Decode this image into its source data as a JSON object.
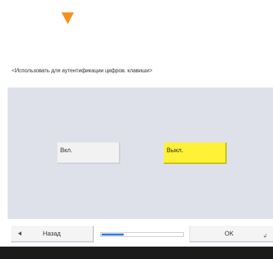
{
  "heading": "<Использовать для аутентификации цифров. клавиши>",
  "options": {
    "on_label": "Вкл.",
    "off_label": "Выкл.",
    "selected": "off"
  },
  "footer": {
    "back_label": "Назад",
    "ok_label": "OK",
    "progress": 0.27
  },
  "icons": {
    "scroll_indicator": "down-triangle-icon",
    "back": "left-arrow-icon",
    "enter": "enter-icon"
  },
  "colors": {
    "accent_orange": "#f5921e",
    "selected_yellow": "#fff136",
    "panel_bg": "#dfe1ea",
    "progress_blue": "#2f7de0"
  }
}
